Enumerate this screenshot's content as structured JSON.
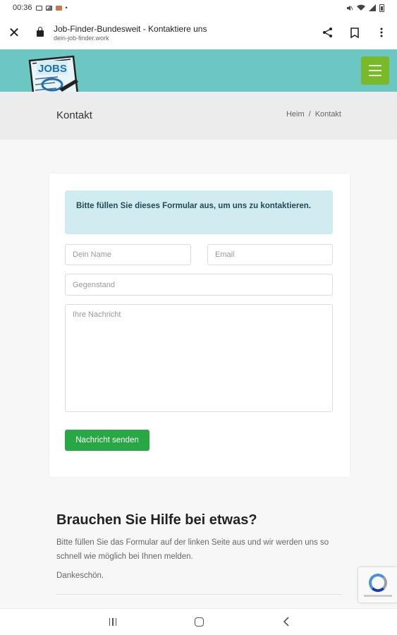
{
  "statusbar": {
    "time": "00:36"
  },
  "browser": {
    "page_title": "Job-Finder-Bundesweit - Kontaktiere uns",
    "url": "dein-job-finder.work"
  },
  "site": {
    "logo_text": "JOBS",
    "colors": {
      "header": "#6cc7c2",
      "menu": "#7ab929",
      "button": "#28a745",
      "alert": "#d1ecf1"
    }
  },
  "page": {
    "title": "Kontakt",
    "breadcrumb": {
      "home": "Heim",
      "separator": "/",
      "current": "Kontakt"
    }
  },
  "form": {
    "alert": "Bitte füllen Sie dieses Formular aus, um uns zu kontaktieren.",
    "name_placeholder": "Dein Name",
    "email_placeholder": "Email",
    "subject_placeholder": "Gegenstand",
    "message_placeholder": "Ihre Nachricht",
    "submit_label": "Nachricht senden"
  },
  "help": {
    "heading": "Brauchen Sie Hilfe bei etwas?",
    "text": "Bitte füllen Sie das Formular auf der linken Seite aus und wir werden uns so schnell wie möglich bei Ihnen melden.",
    "thanks": "Dankeschön."
  }
}
